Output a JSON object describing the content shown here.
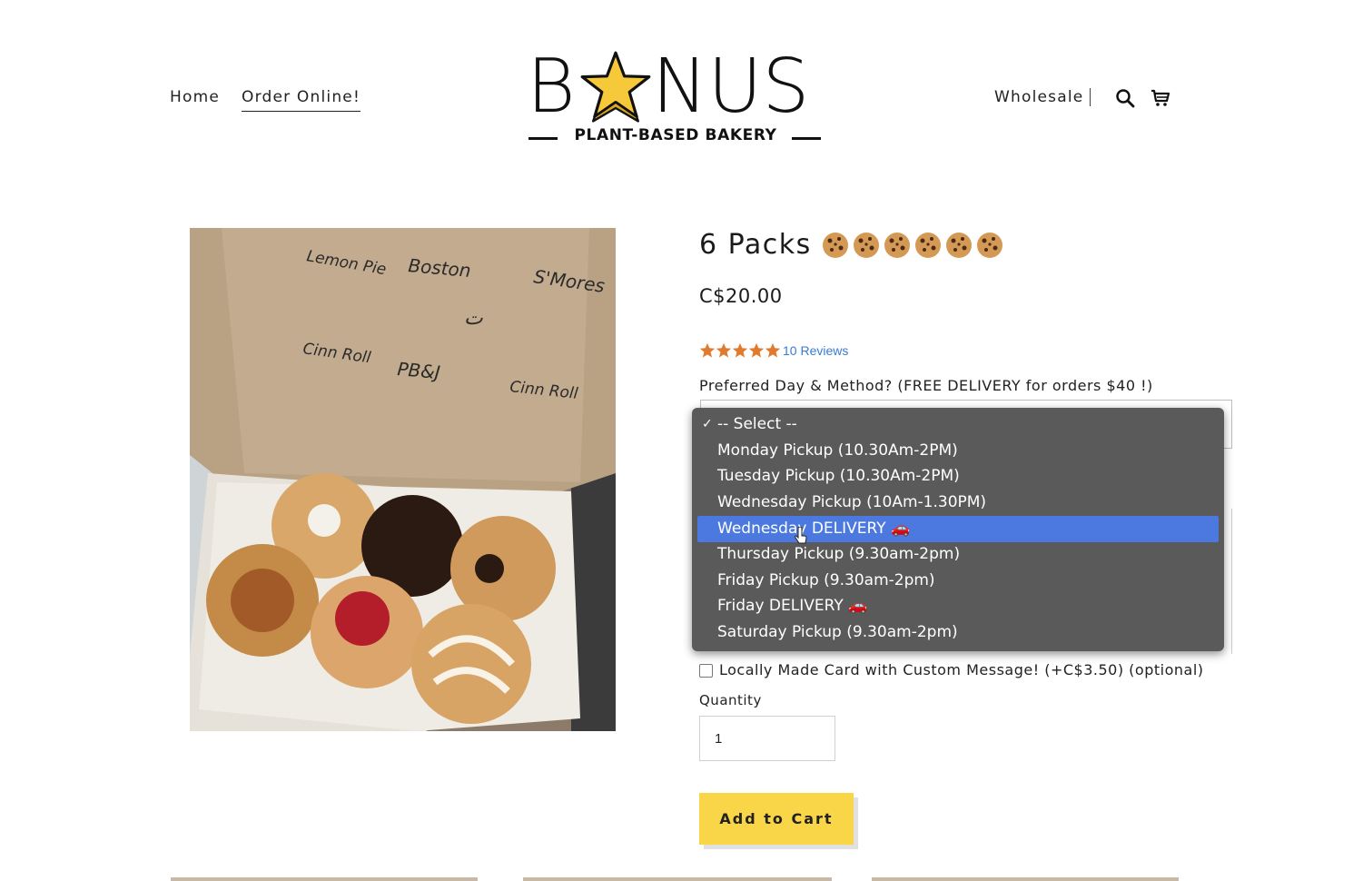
{
  "nav": {
    "home": "Home",
    "order_online": "Order Online!",
    "wholesale": "Wholesale",
    "divider": "|",
    "search_icon": "search-icon",
    "cart_icon": "cart-icon"
  },
  "logo": {
    "word_b": "B",
    "word_rest": "NUS",
    "subtitle": "PLANT-BASED BAKERY",
    "star_color": "#f6c93a"
  },
  "product": {
    "title": "6 Packs",
    "title_emoji": "cookie-icon",
    "emoji_count": 6,
    "price": "C$20.00",
    "rating_stars": 5,
    "star_color": "#e07a2e",
    "reviews": "10 Reviews",
    "photo_notes": [
      "Lemon Pie",
      "Boston",
      "S'Mores",
      "Cinn Roll",
      "PB&J",
      "Cinn Roll"
    ]
  },
  "form": {
    "day_label": "Preferred Day & Method? (FREE DELIVERY for orders $40 !)",
    "options": [
      "-- Select --",
      "Monday Pickup (10.30Am-2PM)",
      "Tuesday Pickup (10.30Am-2PM)",
      "Wednesday Pickup (10Am-1.30PM)",
      "Wednesday DELIVERY 🚗",
      "Thursday Pickup (9.30am-2pm)",
      "Friday Pickup (9.30am-2pm)",
      "Friday DELIVERY 🚗",
      "Saturday Pickup (9.30am-2pm)"
    ],
    "checked_option": "-- Select --",
    "highlighted_option": "Wednesday DELIVERY 🚗",
    "highlight_color": "#4c79e0",
    "card_label": "Locally Made Card with Custom Message! (+C$3.50) (optional)",
    "quantity_label": "Quantity",
    "quantity_value": "1",
    "add_to_cart": "Add to Cart",
    "button_color": "#f9d548"
  }
}
